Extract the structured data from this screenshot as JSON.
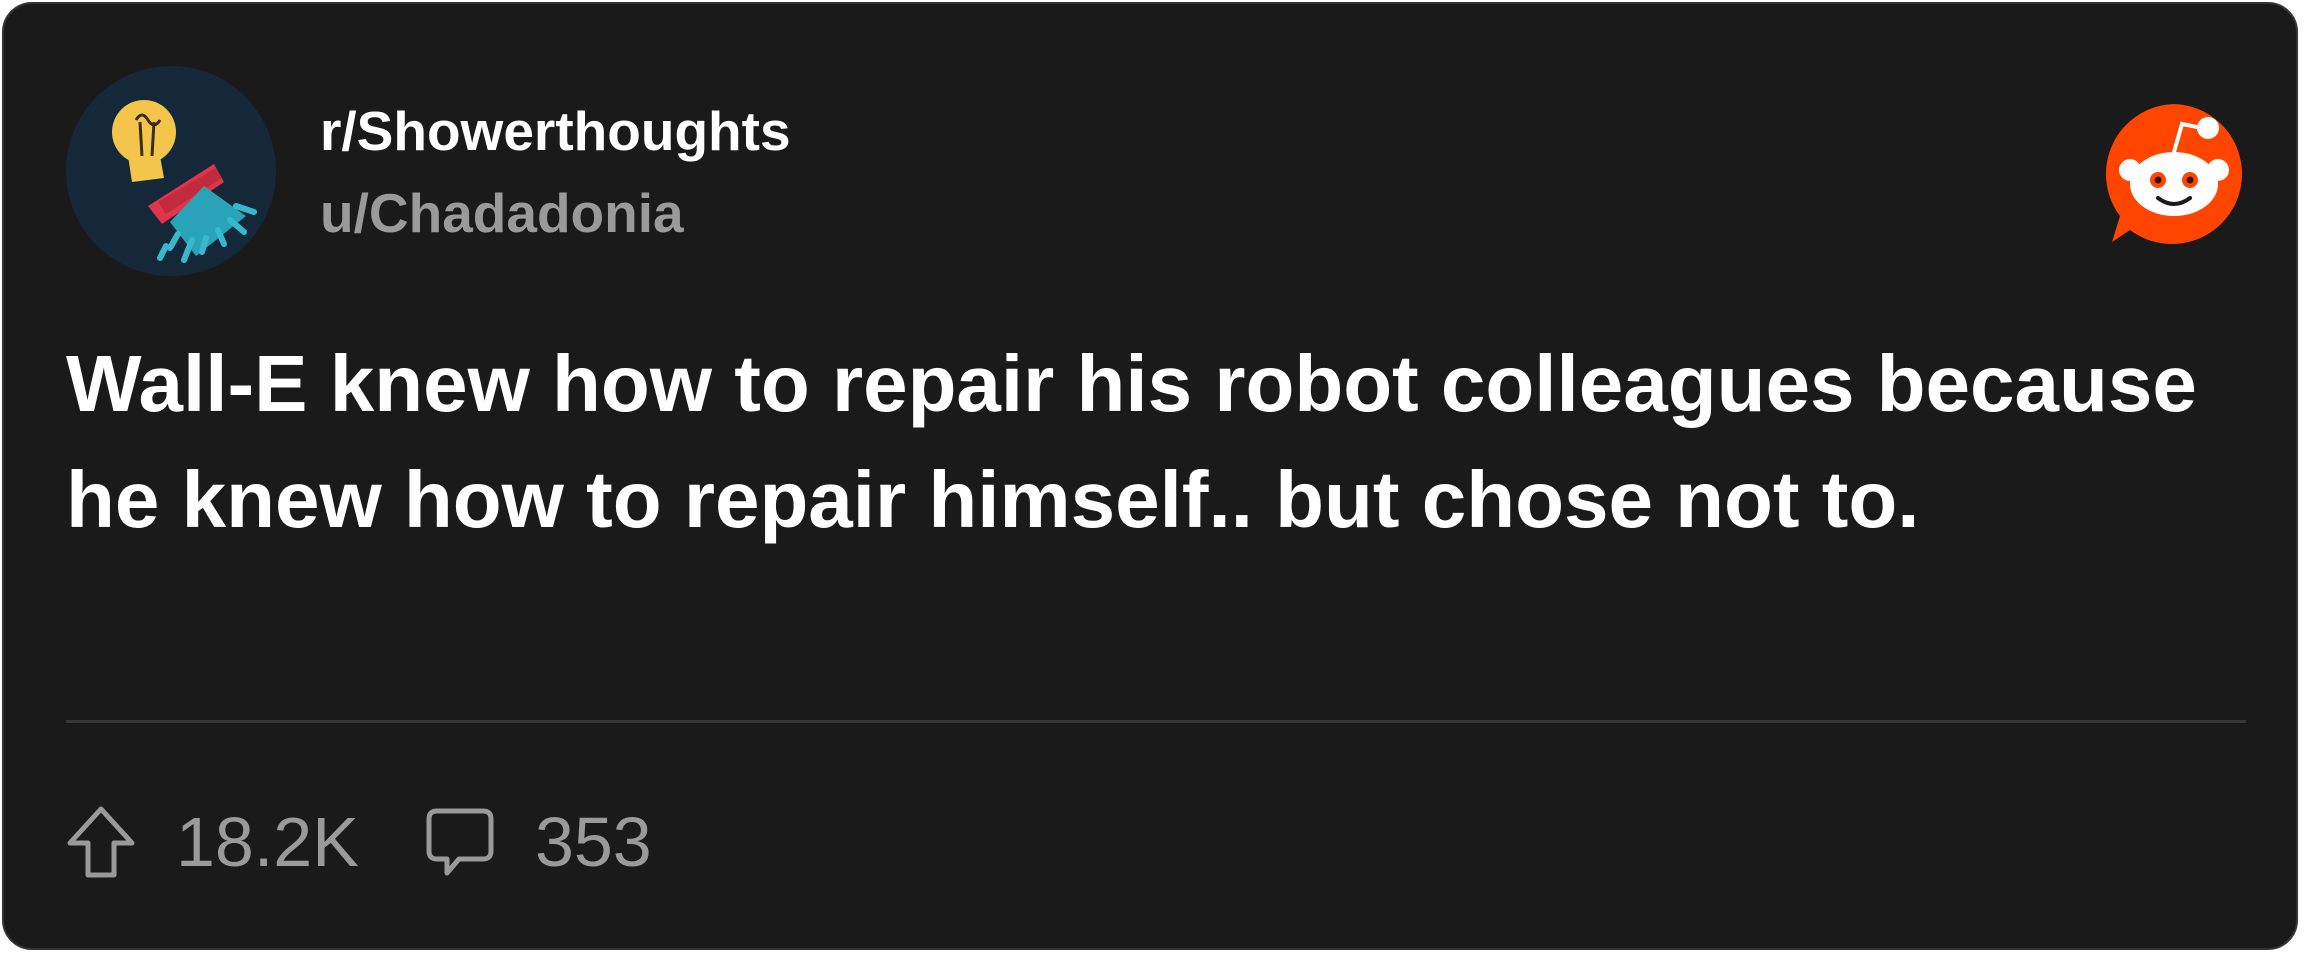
{
  "post": {
    "subreddit": "r/Showerthoughts",
    "author": "u/Chadadonia",
    "title": "Wall-E knew how to repair his robot colleagues because he knew how to repair himself.. but chose not to.",
    "upvotes": "18.2K",
    "comments": "353"
  },
  "icons": {
    "avatar": "showerthoughts-lightbulb-shower-icon",
    "brand": "reddit-snoo-icon",
    "upvote": "upvote-arrow-icon",
    "comment": "comment-bubble-icon"
  },
  "colors": {
    "card_background": "#1a1a1b",
    "primary_text": "#ffffff",
    "secondary_text": "#9a9a9a",
    "reddit_orange": "#ff4500",
    "avatar_background": "#15283a"
  }
}
